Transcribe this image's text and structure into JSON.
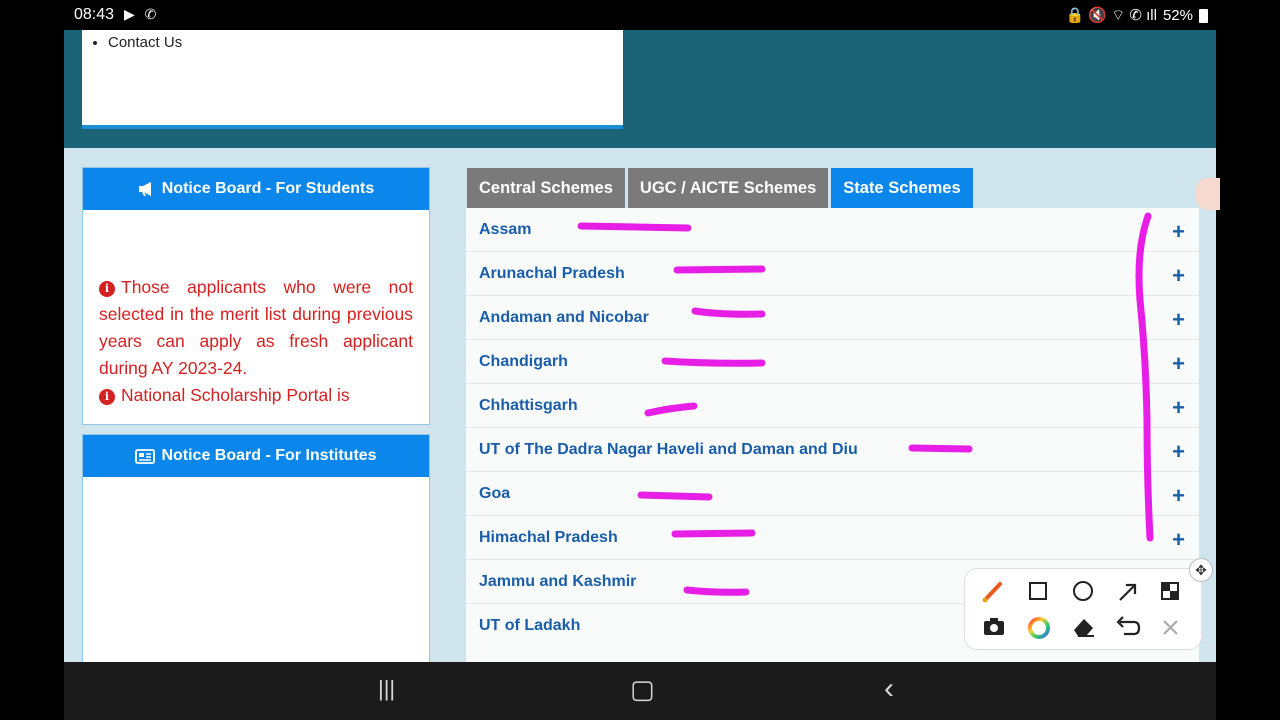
{
  "status_bar": {
    "time": "08:43",
    "left_icons": "▶ ✆",
    "right_icons": "🔒 🔇 ⌔ ✆ ıll",
    "battery": "52%"
  },
  "menu": {
    "items": [
      "Contact Us"
    ]
  },
  "notice_students": {
    "title": "Notice Board - For Students",
    "messages": [
      "Those applicants who were not selected in the merit list during previous years can apply as fresh applicant during AY 2023-24.",
      "National Scholarship Portal is"
    ]
  },
  "notice_institutes": {
    "title": "Notice Board - For Institutes"
  },
  "tabs": [
    {
      "label": "Central Schemes",
      "active": false
    },
    {
      "label": "UGC / AICTE Schemes",
      "active": false
    },
    {
      "label": "State Schemes",
      "active": true
    }
  ],
  "states": [
    "Assam",
    "Arunachal Pradesh",
    "Andaman and Nicobar",
    "Chandigarh",
    "Chhattisgarh",
    "UT of The Dadra Nagar Haveli and Daman and Diu",
    "Goa",
    "Himachal Pradesh",
    "Jammu and Kashmir",
    "UT of Ladakh"
  ],
  "expand_symbol": "+",
  "annotation_color": "#e61ee6",
  "colors": {
    "header_band": "#1c6377",
    "accent": "#0b86ea",
    "tab_inactive": "#7a7a7a",
    "notice_text": "#d42121",
    "link": "#1a5da8"
  },
  "toolbar_icons": [
    "brush-icon",
    "rectangle-icon",
    "circle-icon",
    "arrow-icon",
    "mosaic-icon",
    "camera-icon",
    "color-wheel-icon",
    "eraser-icon",
    "undo-icon",
    "close-icon"
  ],
  "nav": {
    "recents": "|||",
    "home": "▢",
    "back": "‹"
  }
}
